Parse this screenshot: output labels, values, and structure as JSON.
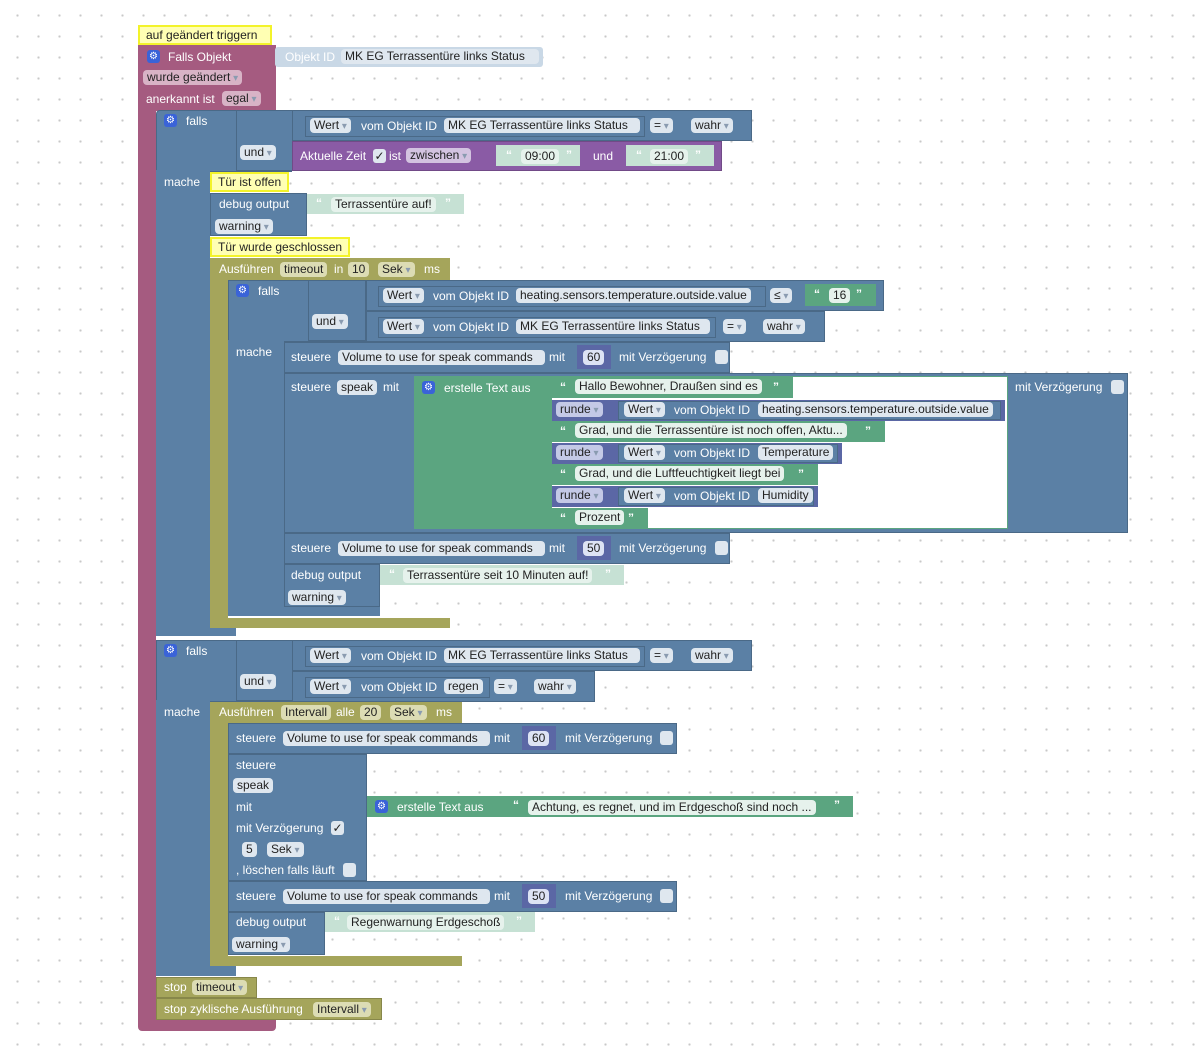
{
  "colors": {
    "event": "#a55b80",
    "logic": "#5b80a5",
    "timer": "#a5a55b",
    "text": "#5ba580",
    "time": "#8a5ba5",
    "math": "#5b67a5",
    "comment": "#ffffb3"
  },
  "trigger": {
    "comment": "auf geändert triggern",
    "label": "Falls Objekt",
    "objekt_id_label": "Objekt ID",
    "objekt_id": "MK EG Terrassentüre links Status",
    "change": "wurde geändert",
    "ack_label": "anerkannt ist",
    "ack": "egal"
  },
  "if1": {
    "falls": "falls",
    "mache": "mache",
    "logic": "und",
    "cond1": {
      "wert": "Wert",
      "vom": "vom Objekt ID",
      "id": "MK EG Terrassentüre links Status",
      "op": "=",
      "value": "wahr"
    },
    "time": {
      "label": "Aktuelle Zeit",
      "checked": true,
      "ist": "ist",
      "mode": "zwischen",
      "from": "09:00",
      "und": "und",
      "to": "21:00"
    },
    "comment_open": "Tür ist offen",
    "debug": {
      "label": "debug output",
      "text": "Terrassentüre auf!",
      "level": "warning"
    },
    "comment_closed": "Tür wurde geschlossen",
    "run": {
      "label": "Ausführen",
      "name": "timeout",
      "in": "in",
      "value": "10",
      "unit": "Sek",
      "ms": "ms"
    },
    "inner": {
      "falls": "falls",
      "mache": "mache",
      "logic": "und",
      "cond1": {
        "wert": "Wert",
        "vom": "vom Objekt ID",
        "id": "heating.sensors.temperature.outside.value",
        "op": "≤",
        "value": "16"
      },
      "cond2": {
        "wert": "Wert",
        "vom": "vom Objekt ID",
        "id": "MK EG Terrassentüre links Status",
        "op": "=",
        "value": "wahr"
      },
      "set1": {
        "label": "steuere",
        "target": "Volume to use for speak commands",
        "mit": "mit",
        "value": "60",
        "delay": "mit Verzögerung"
      },
      "speak": {
        "label": "steuere",
        "target": "speak",
        "mit": "mit",
        "join": "erstelle Text aus",
        "delay": "mit Verzögerung",
        "parts": [
          {
            "type": "text",
            "value": "Hallo Bewohner, Draußen sind es"
          },
          {
            "type": "round",
            "round": "runde",
            "wert": "Wert",
            "vom": "vom Objekt ID",
            "id": "heating.sensors.temperature.outside.value"
          },
          {
            "type": "text",
            "value": "Grad, und die Terrassentüre ist noch offen, Aktu..."
          },
          {
            "type": "round",
            "round": "runde",
            "wert": "Wert",
            "vom": "vom Objekt ID",
            "id": "Temperature"
          },
          {
            "type": "text",
            "value": "Grad, und die Luftfeuchtigkeit liegt bei"
          },
          {
            "type": "round",
            "round": "runde",
            "wert": "Wert",
            "vom": "vom Objekt ID",
            "id": "Humidity"
          },
          {
            "type": "text",
            "value": "Prozent"
          }
        ]
      },
      "set2": {
        "label": "steuere",
        "target": "Volume to use for speak commands",
        "mit": "mit",
        "value": "50",
        "delay": "mit Verzögerung"
      },
      "debug": {
        "label": "debug output",
        "text": "Terrassentüre seit 10 Minuten auf!",
        "level": "warning"
      }
    }
  },
  "if2": {
    "falls": "falls",
    "mache": "mache",
    "logic": "und",
    "cond1": {
      "wert": "Wert",
      "vom": "vom Objekt ID",
      "id": "MK EG Terrassentüre links Status",
      "op": "=",
      "value": "wahr"
    },
    "cond2": {
      "wert": "Wert",
      "vom": "vom Objekt ID",
      "id": "regen",
      "op": "=",
      "value": "wahr"
    },
    "run": {
      "label": "Ausführen",
      "name": "Intervall",
      "alle": "alle",
      "value": "20",
      "unit": "Sek",
      "ms": "ms"
    },
    "set1": {
      "label": "steuere",
      "target": "Volume to use for speak commands",
      "mit": "mit",
      "value": "60",
      "delay": "mit Verzögerung"
    },
    "speak": {
      "label": "steuere",
      "target": "speak",
      "mit": "mit",
      "delay": "mit Verzögerung",
      "delay_checked": true,
      "delay_value": "5",
      "delay_unit": "Sek",
      "clear": ", löschen falls läuft",
      "join": "erstelle Text aus",
      "text": "Achtung, es regnet, und im Erdgeschoß sind noch ..."
    },
    "set2": {
      "label": "steuere",
      "target": "Volume to use for speak commands",
      "mit": "mit",
      "value": "50",
      "delay": "mit Verzögerung"
    },
    "debug": {
      "label": "debug output",
      "text": "Regenwarnung Erdgeschoß",
      "level": "warning"
    }
  },
  "stop1": {
    "label": "stop",
    "name": "timeout"
  },
  "stop2": {
    "label": "stop zyklische Ausführung",
    "name": "Intervall"
  }
}
